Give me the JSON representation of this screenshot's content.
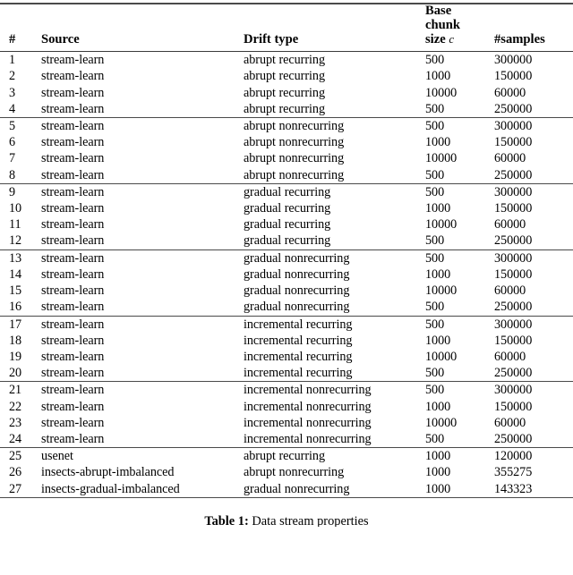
{
  "document": {
    "type": "academic-table",
    "caption_label": "Table 1:",
    "caption_text": "Data stream properties"
  },
  "table": {
    "columns": [
      {
        "key": "num",
        "header": "#",
        "align": "left"
      },
      {
        "key": "source",
        "header": "Source",
        "align": "left"
      },
      {
        "key": "drift",
        "header": "Drift type",
        "align": "left"
      },
      {
        "key": "chunk",
        "header": "Base chunk size",
        "header_lines": [
          "Base",
          "chunk",
          "size"
        ],
        "header_math": "c",
        "align": "left"
      },
      {
        "key": "samples",
        "header": "#samples",
        "align": "left"
      }
    ],
    "rows": [
      {
        "num": "1",
        "source": "stream-learn",
        "drift": "abrupt recurring",
        "chunk": "500",
        "samples": "300000",
        "group_start": true
      },
      {
        "num": "2",
        "source": "stream-learn",
        "drift": "abrupt recurring",
        "chunk": "1000",
        "samples": "150000",
        "group_start": false
      },
      {
        "num": "3",
        "source": "stream-learn",
        "drift": "abrupt recurring",
        "chunk": "10000",
        "samples": "60000",
        "group_start": false
      },
      {
        "num": "4",
        "source": "stream-learn",
        "drift": "abrupt recurring",
        "chunk": "500",
        "samples": "250000",
        "group_start": false
      },
      {
        "num": "5",
        "source": "stream-learn",
        "drift": "abrupt nonrecurring",
        "chunk": "500",
        "samples": "300000",
        "group_start": true
      },
      {
        "num": "6",
        "source": "stream-learn",
        "drift": "abrupt nonrecurring",
        "chunk": "1000",
        "samples": "150000",
        "group_start": false
      },
      {
        "num": "7",
        "source": "stream-learn",
        "drift": "abrupt nonrecurring",
        "chunk": "10000",
        "samples": "60000",
        "group_start": false
      },
      {
        "num": "8",
        "source": "stream-learn",
        "drift": "abrupt nonrecurring",
        "chunk": "500",
        "samples": "250000",
        "group_start": false
      },
      {
        "num": "9",
        "source": "stream-learn",
        "drift": "gradual recurring",
        "chunk": "500",
        "samples": "300000",
        "group_start": true
      },
      {
        "num": "10",
        "source": "stream-learn",
        "drift": "gradual recurring",
        "chunk": "1000",
        "samples": "150000",
        "group_start": false
      },
      {
        "num": "11",
        "source": "stream-learn",
        "drift": "gradual recurring",
        "chunk": "10000",
        "samples": "60000",
        "group_start": false
      },
      {
        "num": "12",
        "source": "stream-learn",
        "drift": "gradual recurring",
        "chunk": "500",
        "samples": "250000",
        "group_start": false
      },
      {
        "num": "13",
        "source": "stream-learn",
        "drift": "gradual nonrecurring",
        "chunk": "500",
        "samples": "300000",
        "group_start": true
      },
      {
        "num": "14",
        "source": "stream-learn",
        "drift": "gradual nonrecurring",
        "chunk": "1000",
        "samples": "150000",
        "group_start": false
      },
      {
        "num": "15",
        "source": "stream-learn",
        "drift": "gradual nonrecurring",
        "chunk": "10000",
        "samples": "60000",
        "group_start": false
      },
      {
        "num": "16",
        "source": "stream-learn",
        "drift": "gradual nonrecurring",
        "chunk": "500",
        "samples": "250000",
        "group_start": false
      },
      {
        "num": "17",
        "source": "stream-learn",
        "drift": "incremental recurring",
        "chunk": "500",
        "samples": "300000",
        "group_start": true
      },
      {
        "num": "18",
        "source": "stream-learn",
        "drift": "incremental recurring",
        "chunk": "1000",
        "samples": "150000",
        "group_start": false
      },
      {
        "num": "19",
        "source": "stream-learn",
        "drift": "incremental recurring",
        "chunk": "10000",
        "samples": "60000",
        "group_start": false
      },
      {
        "num": "20",
        "source": "stream-learn",
        "drift": "incremental recurring",
        "chunk": "500",
        "samples": "250000",
        "group_start": false
      },
      {
        "num": "21",
        "source": "stream-learn",
        "drift": "incremental nonrecurring",
        "chunk": "500",
        "samples": "300000",
        "group_start": true
      },
      {
        "num": "22",
        "source": "stream-learn",
        "drift": "incremental nonrecurring",
        "chunk": "1000",
        "samples": "150000",
        "group_start": false
      },
      {
        "num": "23",
        "source": "stream-learn",
        "drift": "incremental nonrecurring",
        "chunk": "10000",
        "samples": "60000",
        "group_start": false
      },
      {
        "num": "24",
        "source": "stream-learn",
        "drift": "incremental nonrecurring",
        "chunk": "500",
        "samples": "250000",
        "group_start": false
      },
      {
        "num": "25",
        "source": "usenet",
        "drift": "abrupt recurring",
        "chunk": "1000",
        "samples": "120000",
        "group_start": true
      },
      {
        "num": "26",
        "source": "insects-abrupt-imbalanced",
        "drift": "abrupt nonrecurring",
        "chunk": "1000",
        "samples": "355275",
        "group_start": false
      },
      {
        "num": "27",
        "source": "insects-gradual-imbalanced",
        "drift": "gradual nonrecurring",
        "chunk": "1000",
        "samples": "143323",
        "group_start": false
      }
    ]
  },
  "style": {
    "rule_color": "#4a4a4a",
    "text_color": "#000000",
    "background": "#ffffff"
  }
}
